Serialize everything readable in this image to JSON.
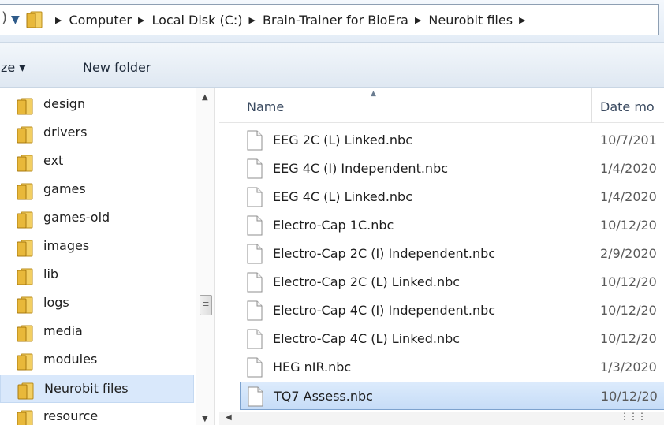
{
  "breadcrumb": {
    "items": [
      "Computer",
      "Local Disk (C:)",
      "Brain-Trainer for BioEra",
      "Neurobit files"
    ]
  },
  "toolbar": {
    "organize_label": "ze ▾",
    "new_folder_label": "New folder"
  },
  "nav": {
    "items": [
      {
        "label": "design",
        "selected": false
      },
      {
        "label": "drivers",
        "selected": false
      },
      {
        "label": "ext",
        "selected": false
      },
      {
        "label": "games",
        "selected": false
      },
      {
        "label": "games-old",
        "selected": false
      },
      {
        "label": "images",
        "selected": false
      },
      {
        "label": "lib",
        "selected": false
      },
      {
        "label": "logs",
        "selected": false
      },
      {
        "label": "media",
        "selected": false
      },
      {
        "label": "modules",
        "selected": false
      },
      {
        "label": "Neurobit files",
        "selected": true
      },
      {
        "label": "resource",
        "selected": false
      }
    ]
  },
  "columns": {
    "name": "Name",
    "date": "Date mo"
  },
  "files": [
    {
      "name": "EEG 2C (L) Linked.nbc",
      "date": "10/7/201",
      "selected": false
    },
    {
      "name": "EEG 4C (I) Independent.nbc",
      "date": "1/4/2020",
      "selected": false
    },
    {
      "name": "EEG 4C (L) Linked.nbc",
      "date": "1/4/2020",
      "selected": false
    },
    {
      "name": "Electro-Cap 1C.nbc",
      "date": "10/12/20",
      "selected": false
    },
    {
      "name": "Electro-Cap 2C (I) Independent.nbc",
      "date": "2/9/2020",
      "selected": false
    },
    {
      "name": "Electro-Cap 2C (L) Linked.nbc",
      "date": "10/12/20",
      "selected": false
    },
    {
      "name": "Electro-Cap 4C (I) Independent.nbc",
      "date": "10/12/20",
      "selected": false
    },
    {
      "name": "Electro-Cap 4C (L) Linked.nbc",
      "date": "10/12/20",
      "selected": false
    },
    {
      "name": "HEG nIR.nbc",
      "date": "1/3/2020",
      "selected": false
    },
    {
      "name": "TQ7 Assess.nbc",
      "date": "10/12/20",
      "selected": true
    }
  ],
  "colors": {
    "folder": "#e8b83a",
    "selection": "#cde0f8",
    "accent": "#2f5b8a"
  },
  "icons": {
    "folder": "folder-icon",
    "document": "document-icon",
    "separator": "chevron-right-icon"
  }
}
